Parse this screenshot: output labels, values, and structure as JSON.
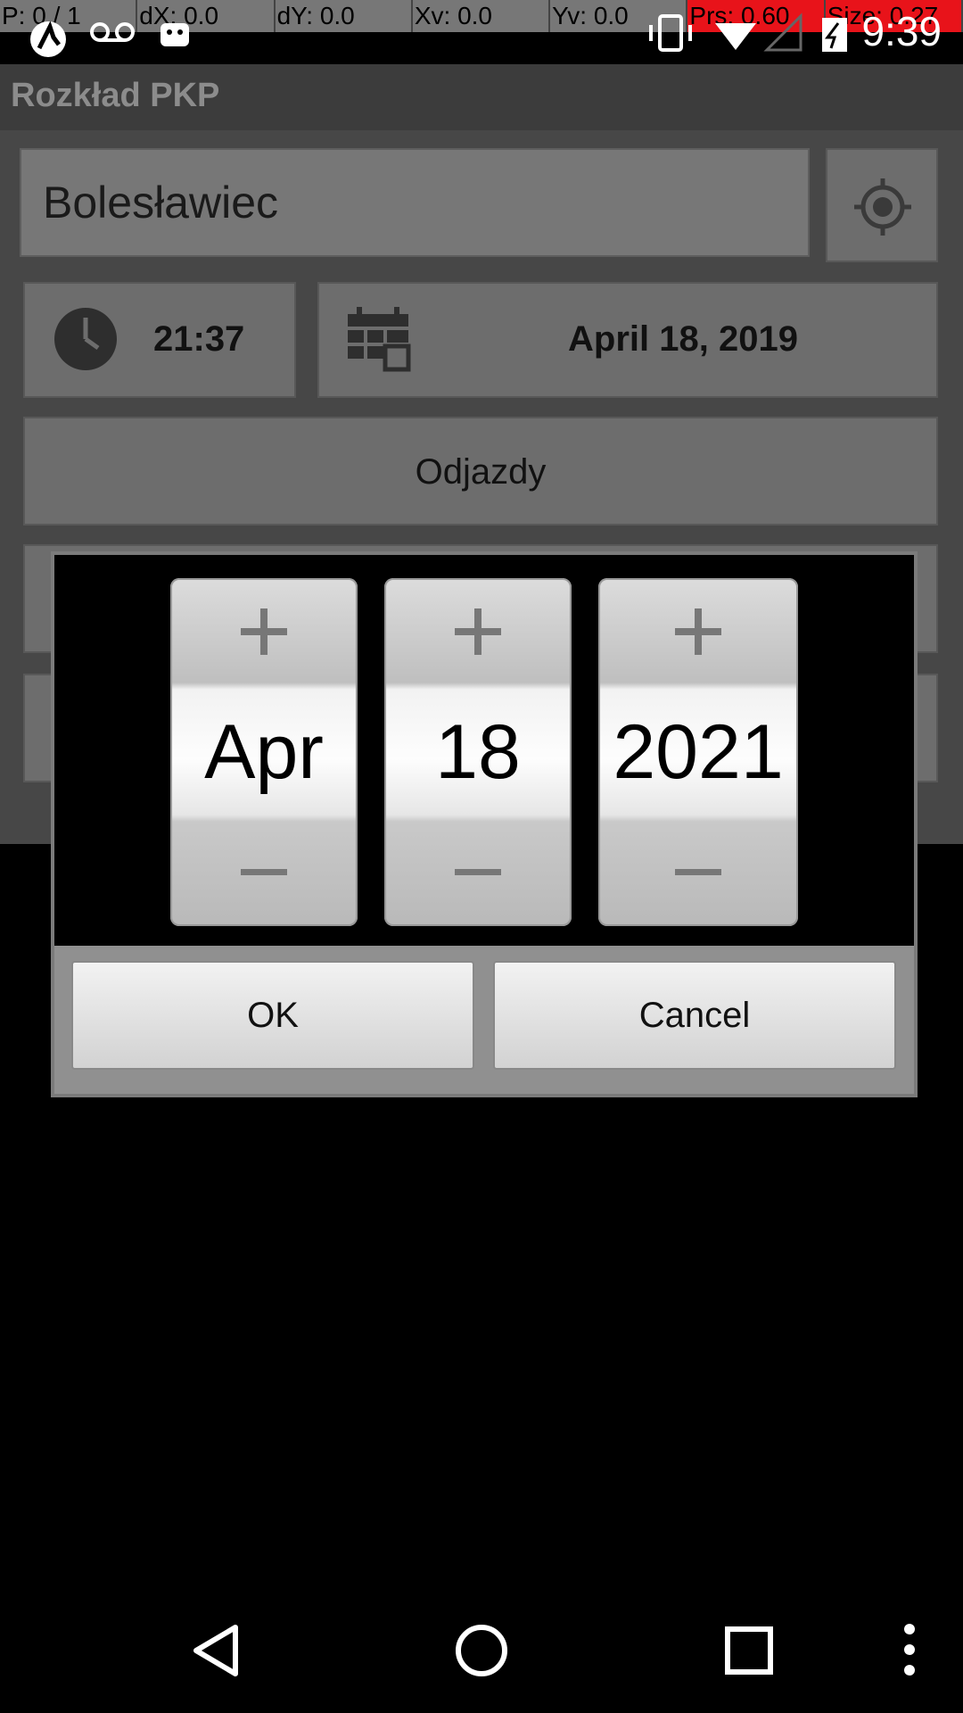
{
  "debug_bar": {
    "items": [
      "P: 0 / 1",
      "dX: 0.0",
      "dY: 0.0",
      "Xv: 0.0",
      "Yv: 0.0",
      "Prs: 0.60",
      "Size: 0.27"
    ]
  },
  "status_bar": {
    "time": "9:39",
    "icons": [
      "app-notification-icon",
      "voicemail-icon",
      "android-icon",
      "vibrate-icon",
      "wifi-icon",
      "signal-icon",
      "battery-charging-icon"
    ]
  },
  "app": {
    "title": "Rozkład PKP"
  },
  "form": {
    "station_value": "Bolesławiec",
    "time_value": "21:37",
    "date_value": "April 18, 2019",
    "departures_label": "Odjazdy"
  },
  "date_picker": {
    "month": "Apr",
    "day": "18",
    "year": "2021",
    "ok_label": "OK",
    "cancel_label": "Cancel"
  },
  "nav_bar": {
    "icons": [
      "back-icon",
      "home-icon",
      "recents-icon",
      "menu-icon"
    ]
  },
  "colors": {
    "background": "#000000",
    "debug_highlight": "#e8131a"
  }
}
